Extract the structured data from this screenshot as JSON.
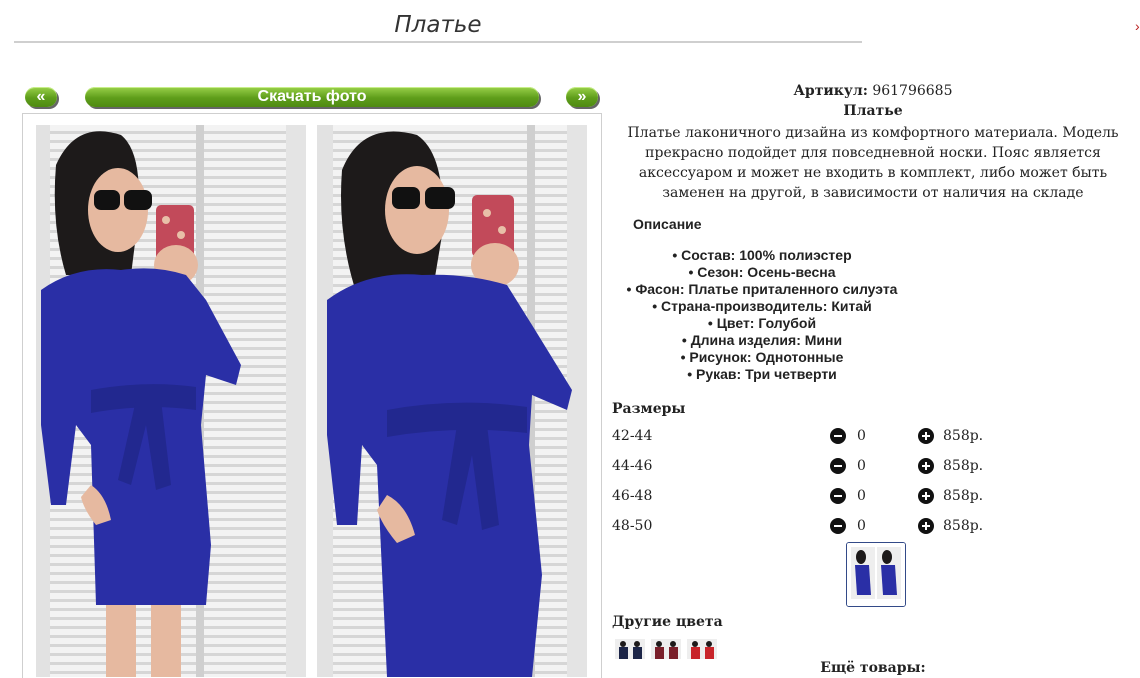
{
  "page": {
    "title": "Платье"
  },
  "gallery": {
    "prev_label": "«",
    "next_label": "»",
    "download_label": "Скачать фото"
  },
  "product": {
    "article_label": "Артикул:",
    "article_value": "961796685",
    "name": "Платье",
    "description": "Платье лаконичного дизайна из комфортного материала. Модель прекрасно подойдет для повседневной носки. Пояс является аксессуаром и может не входить в комплект, либо может быть заменен на другой, в зависимости от наличия на складе"
  },
  "specs": {
    "heading": "Описание",
    "items": [
      "Состав: 100% полиэстер",
      "Сезон: Осень-весна",
      "Фасон: Платье приталенного силуэта",
      "Страна-производитель: Китай",
      "Цвет: Голубой",
      "Длина изделия: Мини",
      "Рисунок: Однотонные",
      "Рукав: Три четверти"
    ]
  },
  "sizes": {
    "heading": "Размеры",
    "rows": [
      {
        "label": "42-44",
        "qty": "0",
        "price": "858р."
      },
      {
        "label": "44-46",
        "qty": "0",
        "price": "858р."
      },
      {
        "label": "46-48",
        "qty": "0",
        "price": "858р."
      },
      {
        "label": "48-50",
        "qty": "0",
        "price": "858р."
      }
    ]
  },
  "other_colors": {
    "heading": "Другие цвета",
    "swatches": [
      {
        "name": "navy",
        "color": "#1c2547"
      },
      {
        "name": "burgundy",
        "color": "#7a1f2a"
      },
      {
        "name": "red",
        "color": "#c8242a"
      }
    ]
  },
  "more": {
    "heading": "Ещё товары:"
  },
  "colors": {
    "dress_blue": "#2a2fa6",
    "button_green": "#5e9d1a",
    "shutter": "#ececec",
    "hair": "#1d1a1a",
    "skin": "#e6b9a0"
  }
}
